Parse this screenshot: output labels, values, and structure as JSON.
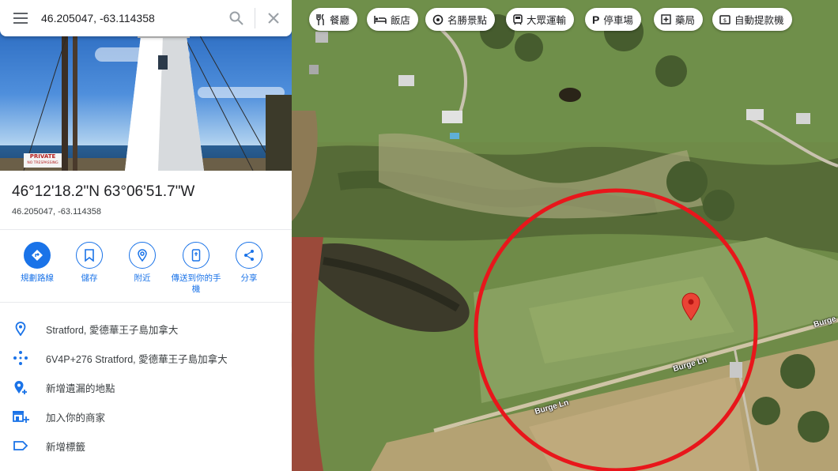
{
  "search": {
    "query": "46.205047, -63.114358"
  },
  "hero": {
    "sign_line1": "PRIVATE",
    "sign_line2": "NO TRESPASSING"
  },
  "place": {
    "title": "46°12'18.2\"N 63°06'51.7\"W",
    "subtitle": "46.205047, -63.114358"
  },
  "actions": [
    {
      "label": "規劃路線",
      "icon": "directions-icon"
    },
    {
      "label": "儲存",
      "icon": "bookmark-icon"
    },
    {
      "label": "附近",
      "icon": "nearby-icon"
    },
    {
      "label": "傳送到你的手機",
      "icon": "phone-icon"
    },
    {
      "label": "分享",
      "icon": "share-icon"
    }
  ],
  "info": [
    {
      "text": "Stratford, 愛德華王子島加拿大",
      "icon": "location-pin-icon"
    },
    {
      "text": "6V4P+276 Stratford, 愛德華王子島加拿大",
      "icon": "plus-code-icon"
    },
    {
      "text": "新增遺漏的地點",
      "icon": "add-place-icon"
    },
    {
      "text": "加入你的商家",
      "icon": "add-business-icon"
    },
    {
      "text": "新增標籤",
      "icon": "label-icon"
    }
  ],
  "chips": [
    {
      "label": "餐廳",
      "icon": "restaurant-icon"
    },
    {
      "label": "飯店",
      "icon": "hotel-icon"
    },
    {
      "label": "名勝景點",
      "icon": "attraction-icon"
    },
    {
      "label": "大眾運輸",
      "icon": "transit-icon"
    },
    {
      "label": "停車場",
      "icon": "parking-icon"
    },
    {
      "label": "藥局",
      "icon": "pharmacy-icon"
    },
    {
      "label": "自動提款機",
      "icon": "atm-icon"
    }
  ],
  "map": {
    "road1": "Burge Ln",
    "road2": "Burge Ln",
    "road3": "Burge"
  },
  "colors": {
    "accent": "#1a73e8",
    "marker": "#ea4335",
    "annotation_circle": "#e8161b"
  }
}
